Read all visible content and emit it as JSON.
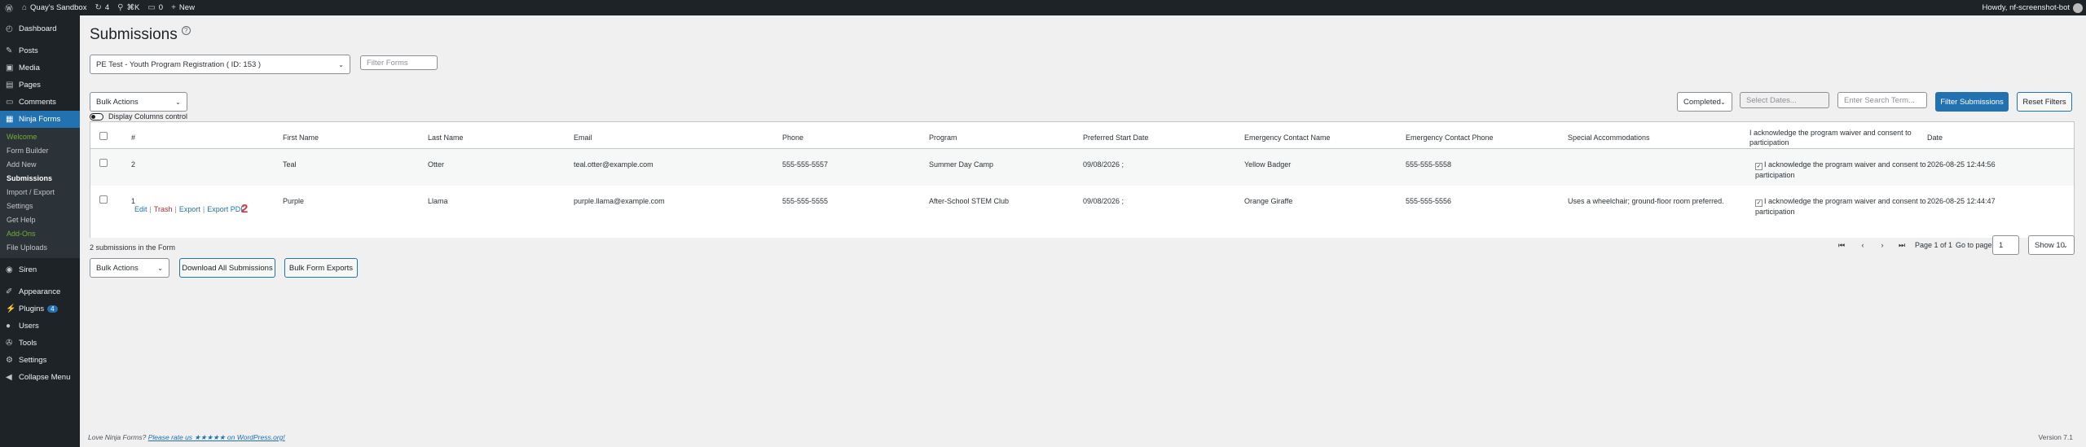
{
  "adminbar": {
    "site": "Quay's Sandbox",
    "updates": "4",
    "shortcut": "⌘K",
    "comments": "0",
    "new": "New",
    "howdy": "Howdy, nf-screenshot-bot"
  },
  "sidebar": {
    "dashboard": "Dashboard",
    "posts": "Posts",
    "media": "Media",
    "pages": "Pages",
    "comments": "Comments",
    "ninja_forms": "Ninja Forms",
    "sub": [
      "Welcome",
      "Form Builder",
      "Add New",
      "Submissions",
      "Import / Export",
      "Settings",
      "Get Help",
      "Add-Ons",
      "File Uploads"
    ],
    "siren": "Siren",
    "appearance": "Appearance",
    "plugins": "Plugins",
    "plugins_badge": "4",
    "users": "Users",
    "tools": "Tools",
    "settings": "Settings",
    "collapse": "Collapse Menu"
  },
  "page": {
    "title": "Submissions",
    "form_select": "PE Test - Youth Program Registration ( ID: 153 )",
    "filter_forms_placeholder": "Filter Forms",
    "bulk_actions": "Bulk Actions",
    "display_columns": "Display Columns control",
    "status_select": "Completed",
    "dates_placeholder": "Select Dates...",
    "search_placeholder": "Enter Search Term...",
    "filter_btn": "Filter Submissions",
    "reset_btn": "Reset Filters"
  },
  "table": {
    "headers": [
      "#",
      "First Name",
      "Last Name",
      "Email",
      "Phone",
      "Program",
      "Preferred Start Date",
      "Emergency Contact Name",
      "Emergency Contact Phone",
      "Special Accommodations",
      "I acknowledge the program waiver and consent to participation",
      "Date"
    ],
    "rows": [
      {
        "num": "2",
        "first": "Teal",
        "last": "Otter",
        "email": "teal.otter@example.com",
        "phone": "555-555-5557",
        "program": "Summer Day Camp",
        "start": "09/08/2026 ;",
        "ec_name": "Yellow Badger",
        "ec_phone": "555-555-5558",
        "special": "",
        "ack": "I acknowledge the program waiver and consent to participation",
        "date": "2026-08-25 12:44:56"
      },
      {
        "num": "1",
        "first": "Purple",
        "last": "Llama",
        "email": "purple.llama@example.com",
        "phone": "555-555-5555",
        "program": "After-School STEM Club",
        "start": "09/08/2026 ;",
        "ec_name": "Orange Giraffe",
        "ec_phone": "555-555-5556",
        "special": "Uses a wheelchair; ground-floor room preferred.",
        "ack": "I acknowledge the program waiver and consent to participation",
        "date": "2026-08-25 12:44:47"
      }
    ],
    "row_actions": {
      "edit": "Edit",
      "trash": "Trash",
      "export": "Export",
      "export_pdf": "Export PDF"
    },
    "annotation": "2"
  },
  "bottom": {
    "count": "2 submissions in the Form",
    "bulk_actions": "Bulk Actions",
    "download_all": "Download All Submissions",
    "bulk_exports": "Bulk Form Exports",
    "page_info": "Page 1 of 1",
    "go_to": "Go to page:",
    "page_value": "1",
    "show": "Show 10"
  },
  "footer": {
    "prefix": "Love Ninja Forms?",
    "link": "Please rate us ★★★★★ on WordPress.org!",
    "version": "Version 7.1"
  }
}
